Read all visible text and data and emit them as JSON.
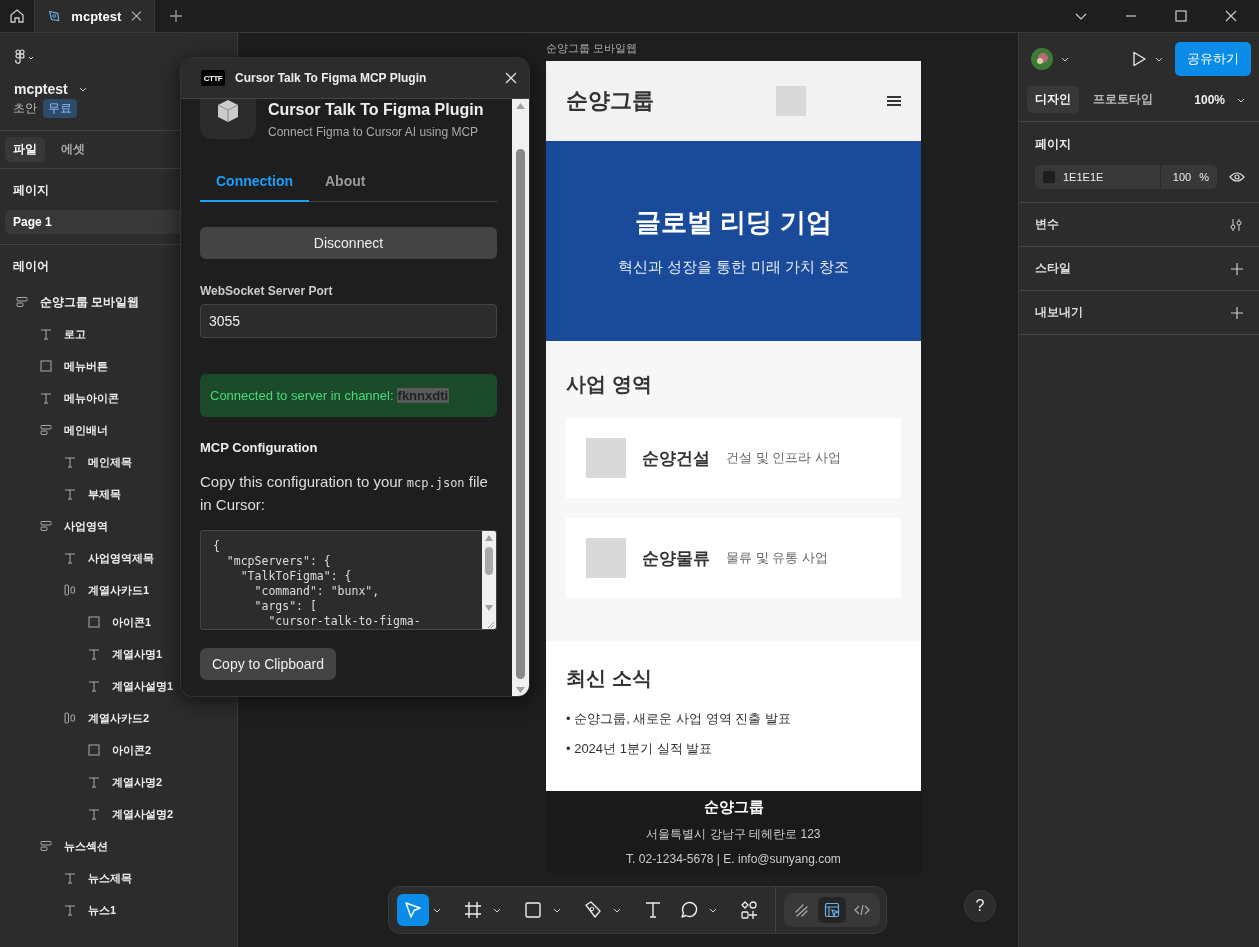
{
  "top_bar": {
    "tabs": [
      {
        "label": "mcptest",
        "selected": true
      }
    ]
  },
  "left_panel": {
    "file_name": "mcptest",
    "status": "초안",
    "plan_badge": "무료",
    "tabs": [
      {
        "label": "파일",
        "selected": true
      },
      {
        "label": "에셋",
        "selected": false
      }
    ],
    "pages_title": "페이지",
    "pages": [
      {
        "label": "Page 1",
        "selected": true
      }
    ],
    "layers_title": "레이어",
    "layers": [
      {
        "name": "순양그룹 모바일웹",
        "kind": "frame",
        "children": [
          {
            "name": "로고",
            "kind": "text"
          },
          {
            "name": "메뉴버튼",
            "kind": "rect"
          },
          {
            "name": "메뉴아이콘",
            "kind": "text"
          },
          {
            "name": "메인배너",
            "kind": "frame",
            "children": [
              {
                "name": "메인제목",
                "kind": "text"
              },
              {
                "name": "부제목",
                "kind": "text"
              }
            ]
          },
          {
            "name": "사업영역",
            "kind": "frame",
            "children": [
              {
                "name": "사업영역제목",
                "kind": "text"
              },
              {
                "name": "계열사카드1",
                "kind": "row",
                "children": [
                  {
                    "name": "아이콘1",
                    "kind": "rect"
                  },
                  {
                    "name": "계열사명1",
                    "kind": "text"
                  },
                  {
                    "name": "계열사설명1",
                    "kind": "text"
                  }
                ]
              },
              {
                "name": "계열사카드2",
                "kind": "row",
                "children": [
                  {
                    "name": "아이콘2",
                    "kind": "rect"
                  },
                  {
                    "name": "계열사명2",
                    "kind": "text"
                  },
                  {
                    "name": "계열사설명2",
                    "kind": "text"
                  }
                ]
              }
            ]
          },
          {
            "name": "뉴스섹션",
            "kind": "frame",
            "children": [
              {
                "name": "뉴스제목",
                "kind": "text"
              },
              {
                "name": "뉴스1",
                "kind": "text"
              }
            ]
          }
        ]
      }
    ]
  },
  "canvas": {
    "frame_label": "순양그룹 모바일웹",
    "page": {
      "logo": "순양그룹",
      "banner_title": "글로벌 리딩 기업",
      "banner_subtitle": "혁신과 성장을 통한 미래 가치 창조",
      "business_title": "사업 영역",
      "cards": [
        {
          "name": "순양건설",
          "desc": "건설 및 인프라 사업"
        },
        {
          "name": "순양물류",
          "desc": "물류 및 유통 사업"
        }
      ],
      "news_title": "최신 소식",
      "news": [
        "• 순양그룹, 새로운 사업 영역 진출 발표",
        "• 2024년 1분기 실적 발표"
      ],
      "footer_title": "순양그룹",
      "footer_address": "서울특별시 강남구 테헤란로 123",
      "footer_contact": "T. 02-1234-5678 | E. info@sunyang.com"
    }
  },
  "plugin": {
    "logo_text": "CTTF",
    "title": "Cursor Talk To Figma MCP Plugin",
    "app_title": "Cursor Talk To Figma Plugin",
    "app_subtitle": "Connect Figma to Cursor AI using MCP",
    "tabs": [
      {
        "label": "Connection",
        "selected": true
      },
      {
        "label": "About",
        "selected": false
      }
    ],
    "disconnect_button": "Disconnect",
    "port_label": "WebSocket Server Port",
    "port_value": "3055",
    "status_text": "Connected to server in channel:",
    "channel": "fknnxdti",
    "config_title": "MCP Configuration",
    "instructions": {
      "before": "Copy this configuration to your",
      "code": "mcp.json",
      "after": "file in Cursor:"
    },
    "config_lines": [
      "{",
      "  \"mcpServers\": {",
      "    \"TalkToFigma\": {",
      "      \"command\": \"bunx\",",
      "      \"args\": [",
      "        \"cursor-talk-to-figma-"
    ],
    "copy_button": "Copy to Clipboard"
  },
  "toolbar": {
    "tools": [
      {
        "kind": "move",
        "selected": true,
        "menu": true
      },
      {
        "kind": "frame",
        "selected": false,
        "menu": true
      },
      {
        "kind": "rect",
        "selected": false,
        "menu": true
      },
      {
        "kind": "pen",
        "selected": false,
        "menu": true
      },
      {
        "kind": "text",
        "selected": false,
        "menu": false
      },
      {
        "kind": "comment",
        "selected": false,
        "menu": true
      },
      {
        "kind": "actions",
        "selected": false,
        "menu": false
      }
    ],
    "modes": [
      {
        "kind": "draw",
        "selected": false
      },
      {
        "kind": "design",
        "selected": true
      },
      {
        "kind": "dev",
        "selected": false
      }
    ]
  },
  "right_panel": {
    "share_button": "공유하기",
    "tabs": [
      {
        "label": "디자인",
        "selected": true
      },
      {
        "label": "프로토타입",
        "selected": false
      }
    ],
    "zoom": "100%",
    "page_title": "페이지",
    "page_color": {
      "hex": "1E1E1E",
      "color": "#1e1e1e",
      "opacity": "100",
      "unit": "%"
    },
    "sections": [
      {
        "title": "변수",
        "kind": "variables"
      },
      {
        "title": "스타일",
        "kind": "add"
      },
      {
        "title": "내보내기",
        "kind": "add"
      }
    ]
  },
  "help_button": "?"
}
